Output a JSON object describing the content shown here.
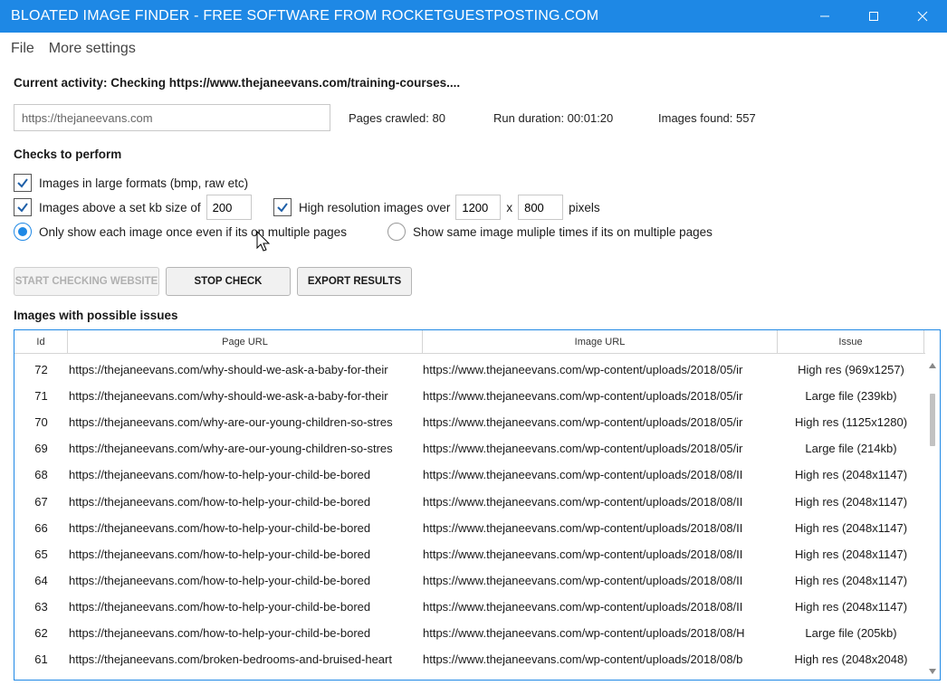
{
  "window": {
    "title": "BLOATED IMAGE FINDER - FREE SOFTWARE FROM ROCKETGUESTPOSTING.COM"
  },
  "menu": [
    "File",
    "More settings"
  ],
  "activity": "Current activity: Checking https://www.thejaneevans.com/training-courses....",
  "url_input": {
    "value": "https://thejaneevans.com"
  },
  "stats": {
    "pages_crawled": "Pages crawled: 80",
    "run_duration": "Run duration: 00:01:20",
    "images_found": "Images found: 557"
  },
  "checks": {
    "title": "Checks to perform",
    "large_formats": {
      "label": "Images in large formats (bmp, raw etc)",
      "checked": true
    },
    "kb_size": {
      "label": "Images above a set kb size of",
      "checked": true,
      "value": "200"
    },
    "high_res": {
      "label": "High resolution images over",
      "checked": true,
      "width": "1200",
      "x": "x",
      "height": "800",
      "unit": "pixels"
    },
    "show_once": {
      "label": "Only show each image once even if its on multiple pages",
      "selected": true
    },
    "show_multiple": {
      "label": "Show same image muliple times if its on multiple pages",
      "selected": false
    }
  },
  "buttons": {
    "start": "START CHECKING WEBSITE",
    "stop": "STOP CHECK",
    "export": "EXPORT RESULTS"
  },
  "results": {
    "title": "Images with possible issues",
    "columns": [
      "Id",
      "Page URL",
      "Image URL",
      "Issue"
    ],
    "rows": [
      {
        "id": "72",
        "page": "https://thejaneevans.com/why-should-we-ask-a-baby-for-their",
        "image": "https://www.thejaneevans.com/wp-content/uploads/2018/05/ir",
        "issue": "High res (969x1257)"
      },
      {
        "id": "71",
        "page": "https://thejaneevans.com/why-should-we-ask-a-baby-for-their",
        "image": "https://www.thejaneevans.com/wp-content/uploads/2018/05/ir",
        "issue": "Large file (239kb)"
      },
      {
        "id": "70",
        "page": "https://thejaneevans.com/why-are-our-young-children-so-stres",
        "image": "https://www.thejaneevans.com/wp-content/uploads/2018/05/ir",
        "issue": "High res (1125x1280)"
      },
      {
        "id": "69",
        "page": "https://thejaneevans.com/why-are-our-young-children-so-stres",
        "image": "https://www.thejaneevans.com/wp-content/uploads/2018/05/ir",
        "issue": "Large file (214kb)"
      },
      {
        "id": "68",
        "page": "https://thejaneevans.com/how-to-help-your-child-be-bored",
        "image": "https://www.thejaneevans.com/wp-content/uploads/2018/08/II",
        "issue": "High res (2048x1147)"
      },
      {
        "id": "67",
        "page": "https://thejaneevans.com/how-to-help-your-child-be-bored",
        "image": "https://www.thejaneevans.com/wp-content/uploads/2018/08/II",
        "issue": "High res (2048x1147)"
      },
      {
        "id": "66",
        "page": "https://thejaneevans.com/how-to-help-your-child-be-bored",
        "image": "https://www.thejaneevans.com/wp-content/uploads/2018/08/II",
        "issue": "High res (2048x1147)"
      },
      {
        "id": "65",
        "page": "https://thejaneevans.com/how-to-help-your-child-be-bored",
        "image": "https://www.thejaneevans.com/wp-content/uploads/2018/08/II",
        "issue": "High res (2048x1147)"
      },
      {
        "id": "64",
        "page": "https://thejaneevans.com/how-to-help-your-child-be-bored",
        "image": "https://www.thejaneevans.com/wp-content/uploads/2018/08/II",
        "issue": "High res (2048x1147)"
      },
      {
        "id": "63",
        "page": "https://thejaneevans.com/how-to-help-your-child-be-bored",
        "image": "https://www.thejaneevans.com/wp-content/uploads/2018/08/II",
        "issue": "High res (2048x1147)"
      },
      {
        "id": "62",
        "page": "https://thejaneevans.com/how-to-help-your-child-be-bored",
        "image": "https://www.thejaneevans.com/wp-content/uploads/2018/08/H",
        "issue": "Large file (205kb)"
      },
      {
        "id": "61",
        "page": "https://thejaneevans.com/broken-bedrooms-and-bruised-heart",
        "image": "https://www.thejaneevans.com/wp-content/uploads/2018/08/b",
        "issue": "High res (2048x2048)"
      }
    ]
  },
  "colors": {
    "accent": "#1e88e5"
  }
}
